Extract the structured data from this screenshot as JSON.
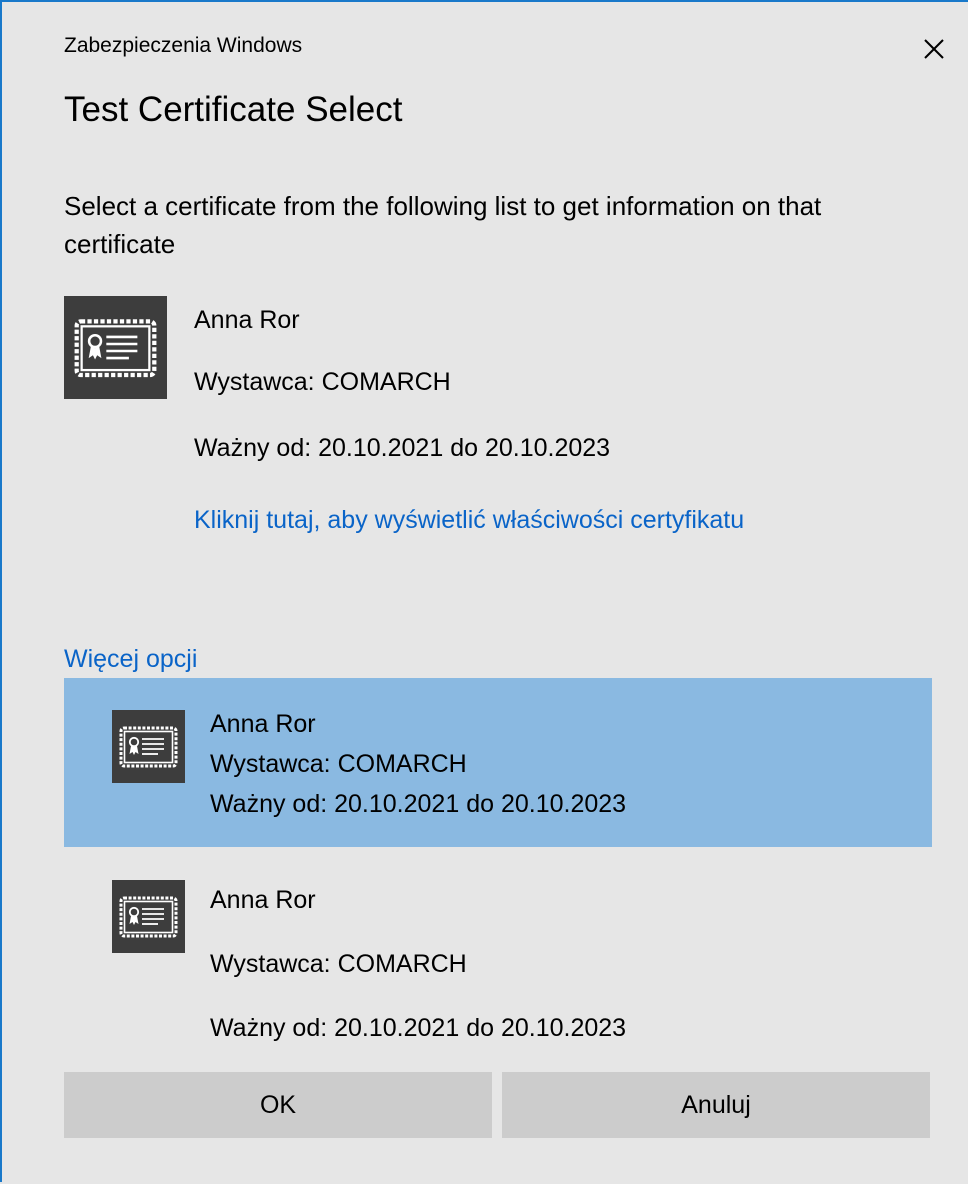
{
  "window": {
    "title": "Zabezpieczenia Windows"
  },
  "dialog": {
    "heading": "Test Certificate Select",
    "description": "Select a certificate from the following list to get information on that certificate"
  },
  "selected_certificate": {
    "name": "Anna  Ror",
    "issuer": "Wystawca:  COMARCH",
    "valid": "Ważny od: 20.10.2021 do 20.10.2023",
    "properties_link": "Kliknij tutaj, aby wyświetlić właściwości certyfikatu"
  },
  "more_options": {
    "label": "Więcej opcji"
  },
  "certificate_list": [
    {
      "name": "Anna Ror",
      "issuer": "Wystawca: COMARCH",
      "valid": "Ważny od: 20.10.2021 do 20.10.2023",
      "selected": true
    },
    {
      "name": "Anna Ror",
      "issuer": "Wystawca:  COMARCH",
      "valid": "Ważny od: 20.10.2021 do 20.10.2023",
      "selected": false
    }
  ],
  "buttons": {
    "ok": "OK",
    "cancel": "Anuluj"
  },
  "colors": {
    "accent_link": "#0a64c8",
    "selection": "#8ab9e1",
    "window_border": "#1979ca",
    "icon_bg": "#3d3d3d",
    "button_bg": "#cccccc"
  },
  "icons": {
    "close": "close-icon",
    "certificate": "certificate-icon"
  }
}
